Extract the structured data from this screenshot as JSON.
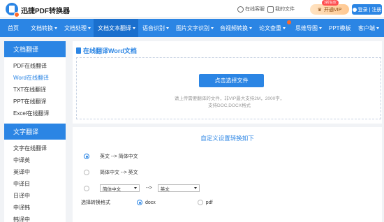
{
  "header": {
    "brand": "迅捷PDF转换器",
    "service_label": "在线客服",
    "docs_label": "我的文件",
    "vip_label": "开通VIP",
    "vip_badge": "3折狂欢",
    "login_label": "登录 | 注册"
  },
  "nav": {
    "items": [
      {
        "label": "首页"
      },
      {
        "label": "文档转换"
      },
      {
        "label": "文档处理"
      },
      {
        "label": "文档文本翻译"
      },
      {
        "label": "语音识别"
      },
      {
        "label": "图片文字识别"
      },
      {
        "label": "音视频转换"
      },
      {
        "label": "论文查重"
      },
      {
        "label": "思维导图"
      },
      {
        "label": "PPT模板"
      },
      {
        "label": "客户端"
      }
    ]
  },
  "sidebar": {
    "section1_title": "文档翻译",
    "section1_items": [
      "PDF在线翻译",
      "Word在线翻译",
      "TXT在线翻译",
      "PPT在线翻译",
      "Excel在线翻译"
    ],
    "section2_title": "文字翻译",
    "section2_items": [
      "文字在线翻译",
      "中译英",
      "英译中",
      "中译日",
      "日译中",
      "中译韩",
      "韩译中"
    ]
  },
  "main": {
    "title": "在线翻译Word文档",
    "choose_button": "点击选择文件",
    "hint_line1": "请上传需要翻译的文件，非VIP最大支持2M，2000字，",
    "hint_line2": "支持DOC,DOCX格式",
    "settings_title": "自定义设置转换如下",
    "option1": "英文 --> 简体中文",
    "option2": "简体中文 --> 英文",
    "custom_source": "简体中文",
    "custom_arrow": "-->",
    "custom_target": "英文",
    "format_label": "选择转换格式",
    "format_docx": "docx",
    "format_pdf": "pdf"
  },
  "colors": {
    "accent": "#2b85e4"
  }
}
